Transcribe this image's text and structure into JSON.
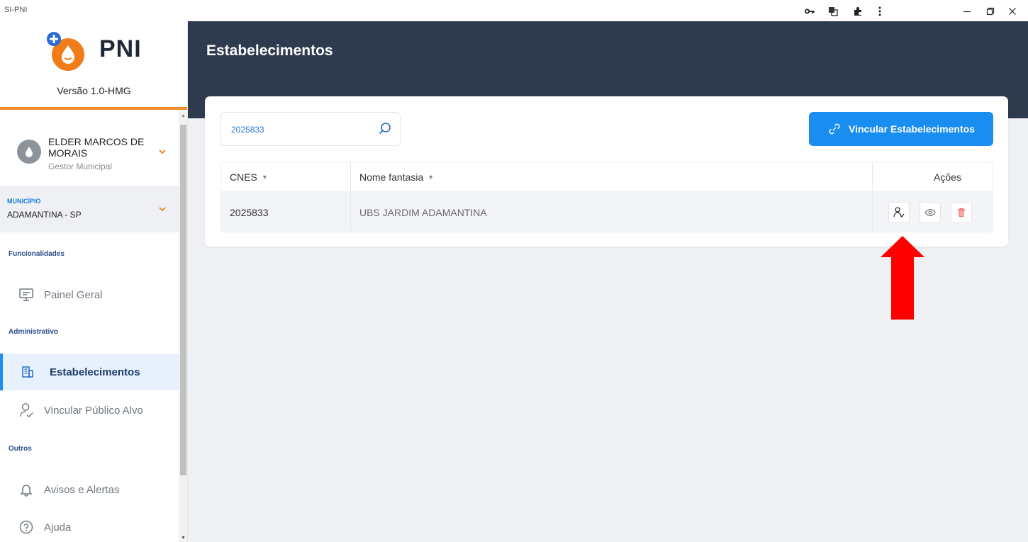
{
  "window": {
    "title": "SI-PNI",
    "controls": [
      "key-icon",
      "translate-icon",
      "extensions-icon",
      "menu-icon",
      "minimize",
      "restore",
      "close"
    ]
  },
  "sidebar": {
    "logo_text": "PNI",
    "version": "Versão 1.0-HMG",
    "user": {
      "name": "ELDER MARCOS DE MORAIS",
      "role": "Gestor Municipal"
    },
    "municipio": {
      "label": "MUNICÍPIO",
      "value": "ADAMANTINA - SP"
    },
    "sections": [
      {
        "label": "Funcionalidades"
      },
      {
        "label": "Administrativo"
      },
      {
        "label": "Outros"
      }
    ],
    "items": [
      {
        "label": "Painel Geral",
        "icon": "monitor-icon"
      },
      {
        "label": "Estabelecimentos",
        "icon": "building-icon",
        "active": true
      },
      {
        "label": "Vincular Público Alvo",
        "icon": "user-link-icon"
      },
      {
        "label": "Avisos e Alertas",
        "icon": "bell-icon"
      },
      {
        "label": "Ajuda",
        "icon": "help-icon"
      }
    ]
  },
  "header": {
    "title": "Estabelecimentos"
  },
  "search": {
    "value": "2025833"
  },
  "actions": {
    "link_button": "Vincular Estabelecimentos"
  },
  "table": {
    "columns": [
      "CNES",
      "Nome fantasia",
      "Ações"
    ],
    "rows": [
      {
        "cnes": "2025833",
        "nome": "UBS JARDIM ADAMANTINA"
      }
    ],
    "row_actions": [
      "link-users-icon",
      "eye-icon",
      "trash-icon"
    ]
  },
  "colors": {
    "header_bg": "#2e3b4e",
    "accent": "#1a8df0",
    "brand_orange": "#f08a2e",
    "annotation_arrow": "#ff0000"
  }
}
